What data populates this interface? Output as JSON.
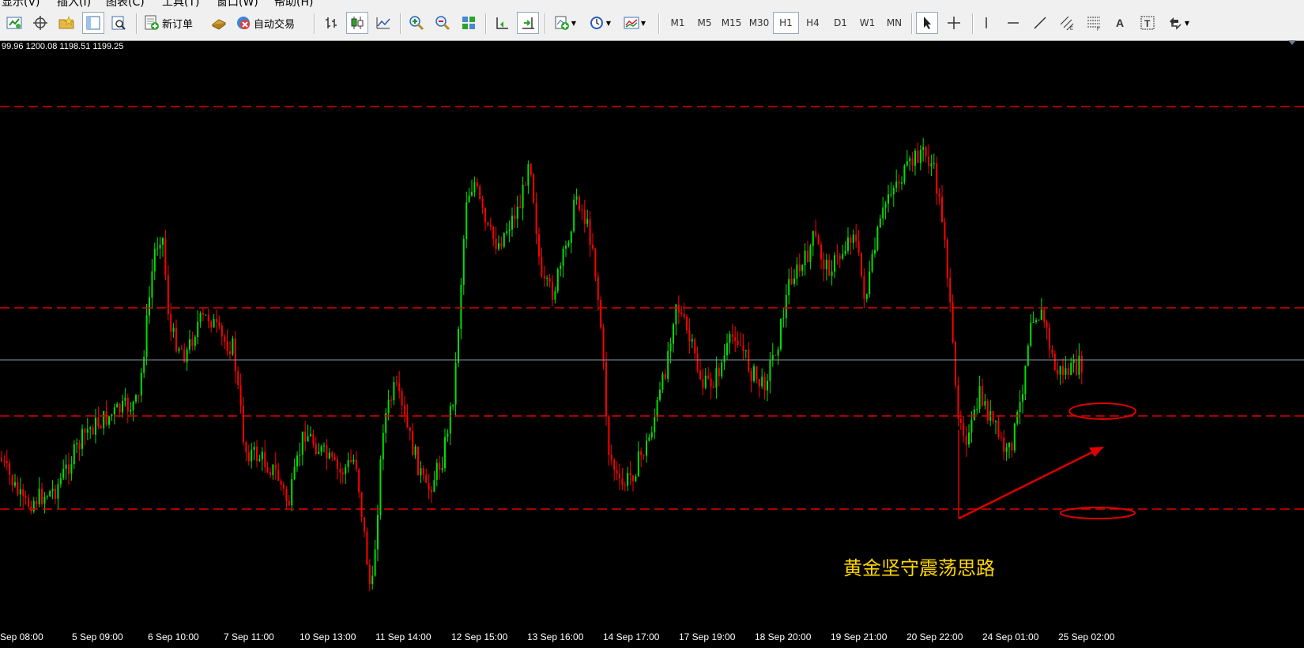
{
  "menu": [
    "显示(V)",
    "插入(I)",
    "图表(C)",
    "工具(T)",
    "窗口(W)",
    "帮助(H)"
  ],
  "toolbar": {
    "new_order_label": "新订单",
    "auto_trade_label": "自动交易",
    "timeframes": [
      "M1",
      "M5",
      "M15",
      "M30",
      "H1",
      "H4",
      "D1",
      "W1",
      "MN"
    ],
    "active_timeframe": "H1"
  },
  "chart": {
    "ohlc_text": "99.96 1200.08 1198.51 1199.25",
    "annotation": "黄金坚守震荡思路",
    "bull_color": "#00e000",
    "bear_color": "#ff0000",
    "level_color": "#e00000"
  },
  "chart_data": {
    "type": "candlestick",
    "x_labels": [
      "Sep 08:00",
      "5 Sep 09:00",
      "6 Sep 10:00",
      "7 Sep 11:00",
      "10 Sep 13:00",
      "11 Sep 14:00",
      "12 Sep 15:00",
      "13 Sep 16:00",
      "14 Sep 17:00",
      "17 Sep 19:00",
      "18 Sep 20:00",
      "19 Sep 21:00",
      "20 Sep 22:00",
      "24 Sep 01:00",
      "25 Sep 02:00"
    ],
    "last_close": 1199.25
  }
}
